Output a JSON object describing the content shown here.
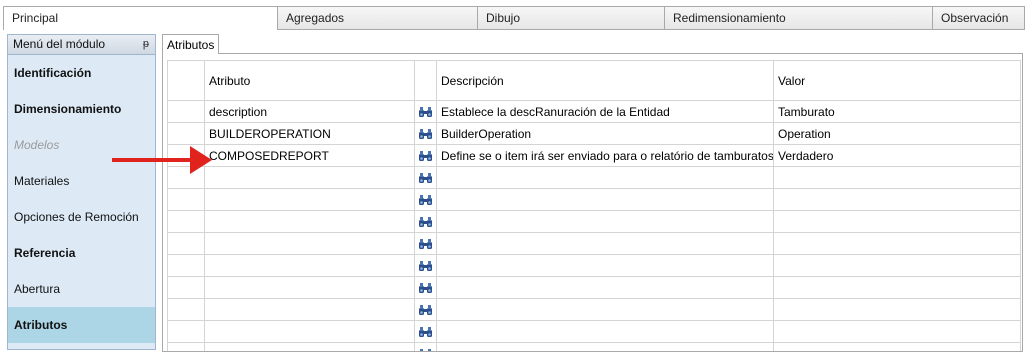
{
  "tabs": [
    {
      "label": "Principal"
    },
    {
      "label": "Agregados"
    },
    {
      "label": "Dibujo"
    },
    {
      "label": "Redimensionamiento"
    },
    {
      "label": "Observación"
    }
  ],
  "sidebar": {
    "title": "Menú del módulo",
    "pin_glyph": "ᵽ",
    "items": [
      {
        "label": "Identificación"
      },
      {
        "label": "Dimensionamiento"
      },
      {
        "label": "Modelos"
      },
      {
        "label": "Materiales"
      },
      {
        "label": "Opciones de Remoción"
      },
      {
        "label": "Referencia"
      },
      {
        "label": "Abertura"
      },
      {
        "label": "Atributos"
      }
    ]
  },
  "panel": {
    "tab_label": "Atributos",
    "columns": {
      "attribute": "Atributo",
      "description": "Descripción",
      "value": "Valor"
    },
    "rows": [
      {
        "attribute": "description",
        "description": "Establece la descRanuración de la Entidad",
        "value": "Tamburato"
      },
      {
        "attribute": "BUILDEROPERATION",
        "description": "BuilderOperation",
        "value": "Operation"
      },
      {
        "attribute": "COMPOSEDREPORT",
        "description": "Define se o item irá ser enviado para o relatório de tamburatos",
        "value": "Verdadero"
      }
    ],
    "icon": "binoculars-icon"
  },
  "colors": {
    "annotation_arrow": "#e0231c",
    "selected_item": "#acd6e6",
    "sidebar_bg": "#ddeaf6"
  }
}
